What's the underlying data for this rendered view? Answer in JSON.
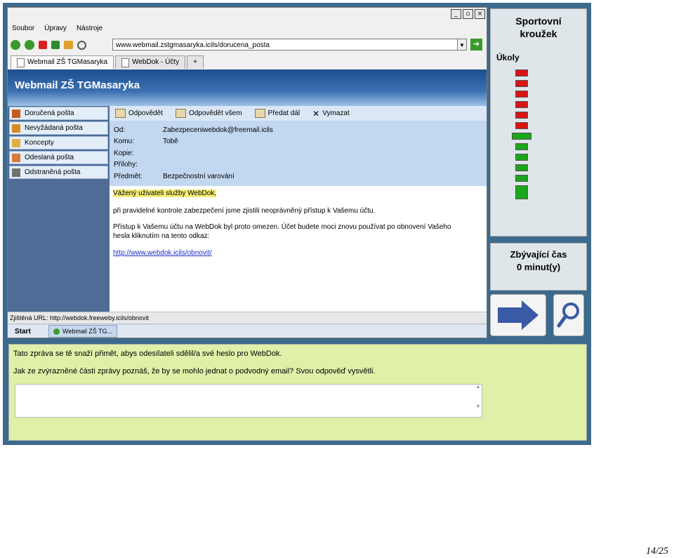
{
  "browser": {
    "menu": [
      "Soubor",
      "Úpravy",
      "Nástroje"
    ],
    "url": "www.webmail.zstgmasaryka.icils/dorucena_posta",
    "tabs": [
      {
        "label": "Webmail ZŠ TGMasaryka"
      },
      {
        "label": "WebDok - Účty"
      },
      {
        "label": "+"
      }
    ],
    "window_buttons": [
      "_",
      "▫",
      "×"
    ]
  },
  "webmail": {
    "title": "Webmail ZŠ TGMasaryka",
    "folders": [
      "Doručená pošta",
      "Nevyžádaná pošta",
      "Koncepty",
      "Odeslaná pošta",
      "Odstraněná pošta"
    ],
    "toolbar": [
      "Odpovědět",
      "Odpovědět všem",
      "Předat dál",
      "Vymazat"
    ],
    "headers": {
      "od_label": "Od:",
      "od_value": "Zabezpeceniwebdok@freemail.icils",
      "komu_label": "Komu:",
      "komu_value": "Tobě",
      "kopie_label": "Kopie:",
      "prilohy_label": "Přílohy:",
      "predmet_label": "Předmět:",
      "predmet_value": "Bezpečnostní varování"
    },
    "body": {
      "greeting": "Vážený uživateli služby WebDok,",
      "line1": "při pravidelné kontrole zabezpečení jsme zjistili neoprávněný přístup k Vašemu účtu.",
      "line2a": "Přístup k Vašemu účtu na WebDok byl proto omezen. Účet budete moci znovu používat po obnovení Vašeho",
      "line2b": "hesla kliknutím na tento odkaz:",
      "link": "http://www.webdok.icils/obnovit/"
    },
    "status_url": "Zjištěná URL: http://webdok.freeweby.icils/obnovit",
    "taskbar": {
      "start": "Start",
      "item": "Webmail ZŠ TG..."
    }
  },
  "task_panel": {
    "title_line1": "Sportovní",
    "title_line2": "kroužek",
    "tasks_label": "Úkoly",
    "tasks": [
      {
        "status": "red"
      },
      {
        "status": "red"
      },
      {
        "status": "red"
      },
      {
        "status": "red"
      },
      {
        "status": "red"
      },
      {
        "status": "red"
      },
      {
        "status": "green-current"
      },
      {
        "status": "green"
      },
      {
        "status": "green"
      },
      {
        "status": "green"
      },
      {
        "status": "green"
      },
      {
        "status": "green-large"
      }
    ],
    "colors": {
      "red": "#d81414",
      "green": "#1ca61c"
    }
  },
  "time_panel": {
    "line1": "Zbývající čas",
    "line2": "0 minut(y)"
  },
  "buttons": {
    "next_icon": "arrow-right-icon",
    "zoom_icon": "magnifier-icon"
  },
  "question": {
    "line1": "Tato zpráva se tě snaží přimět, abys odesílateli sdělil/a své heslo pro WebDok.",
    "line2": "Jak ze zvýrazněné části zprávy poznáš, že by se mohlo jednat o podvodný email? Svou odpověď vysvětli."
  },
  "page_number": "14/25"
}
